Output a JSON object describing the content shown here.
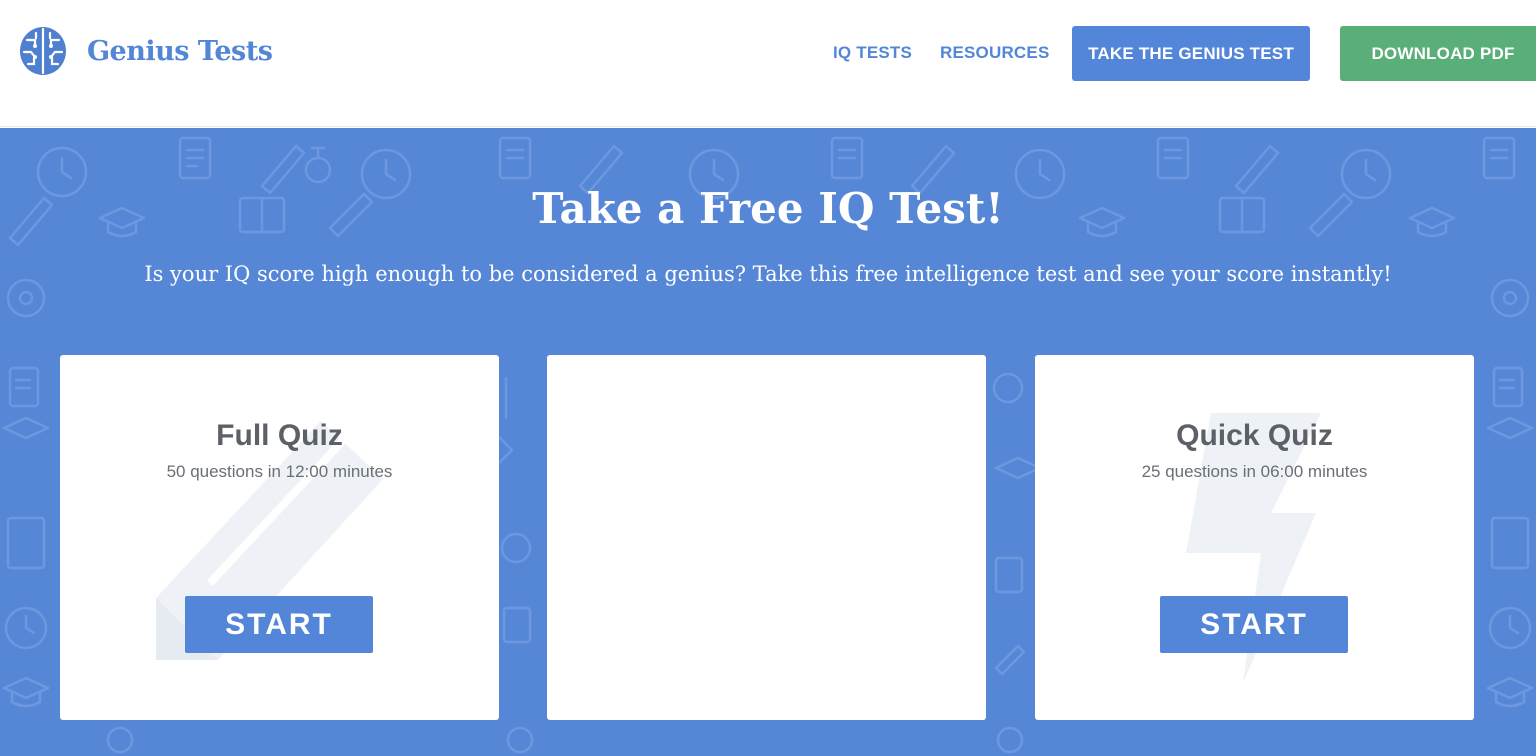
{
  "brand": {
    "name": "Genius Tests",
    "accent": "#5286d6"
  },
  "nav": {
    "iq_tests": "IQ TESTS",
    "resources": "RESOURCES",
    "take_test": "TAKE THE GENIUS TEST",
    "download_pdf": "DOWNLOAD PDF"
  },
  "hero": {
    "title": "Take a Free IQ Test!",
    "subtitle": "Is your IQ score high enough to be considered a genius? Take this free intelligence test and see your score instantly!",
    "background": "#5687d7"
  },
  "cards": [
    {
      "title": "Full Quiz",
      "description": "50 questions in 12:00 minutes",
      "button": "START",
      "icon": "pencil-icon"
    },
    {
      "title": "",
      "description": "",
      "button": "",
      "icon": ""
    },
    {
      "title": "Quick Quiz",
      "description": "25 questions in 06:00 minutes",
      "button": "START",
      "icon": "lightning-icon"
    }
  ],
  "colors": {
    "primary_button": "#5386d8",
    "download_button": "#5aae78"
  }
}
